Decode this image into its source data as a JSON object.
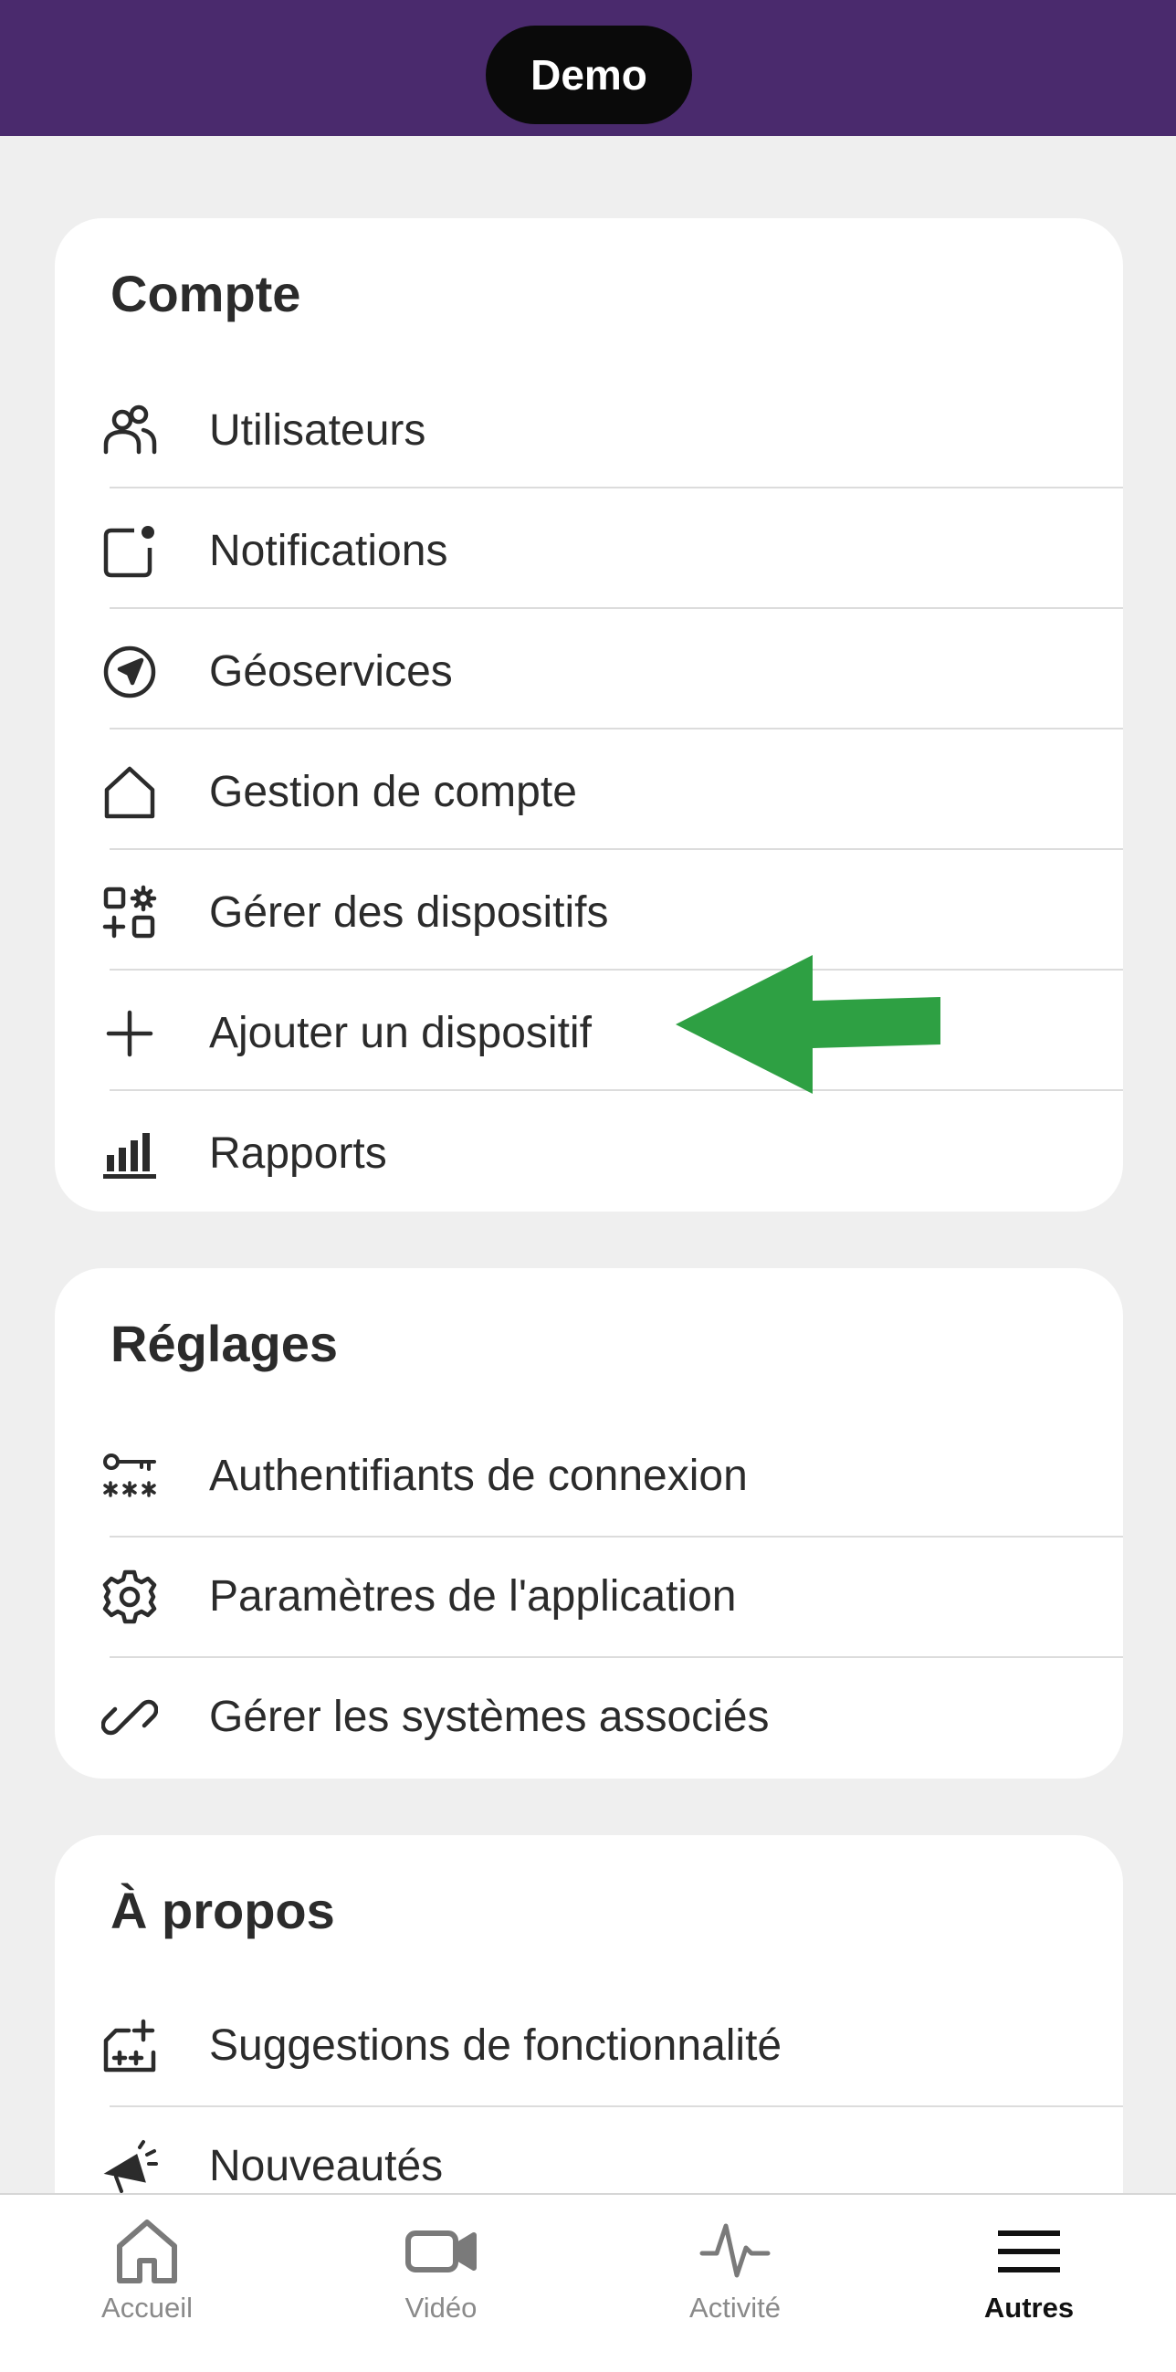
{
  "header": {
    "title": "Demo",
    "background": "#4a2a6d"
  },
  "sections": [
    {
      "title": "Compte",
      "items": [
        {
          "label": "Utilisateurs",
          "icon": "users-icon"
        },
        {
          "label": "Notifications",
          "icon": "notification-icon"
        },
        {
          "label": "Géoservices",
          "icon": "compass-icon"
        },
        {
          "label": "Gestion de compte",
          "icon": "home-icon"
        },
        {
          "label": "Gérer des dispositifs",
          "icon": "manage-devices-icon"
        },
        {
          "label": "Ajouter un dispositif",
          "icon": "plus-icon"
        },
        {
          "label": "Rapports",
          "icon": "bar-chart-icon"
        }
      ]
    },
    {
      "title": "Réglages",
      "items": [
        {
          "label": "Authentifiants de connexion",
          "icon": "key-password-icon"
        },
        {
          "label": "Paramètres de l'application",
          "icon": "gear-icon"
        },
        {
          "label": "Gérer les systèmes associés",
          "icon": "link-icon"
        }
      ]
    },
    {
      "title": "À propos",
      "items": [
        {
          "label": "Suggestions de fonctionnalité",
          "icon": "feature-suggestion-icon"
        },
        {
          "label": "Nouveautés",
          "icon": "megaphone-icon"
        }
      ]
    }
  ],
  "annotation": {
    "arrow_color": "#2ea043",
    "points_to": "Ajouter un dispositif"
  },
  "bottom_nav": {
    "tabs": [
      {
        "label": "Accueil",
        "icon": "home-icon",
        "active": false
      },
      {
        "label": "Vidéo",
        "icon": "video-camera-icon",
        "active": false
      },
      {
        "label": "Activité",
        "icon": "activity-pulse-icon",
        "active": false
      },
      {
        "label": "Autres",
        "icon": "menu-icon",
        "active": true
      }
    ]
  }
}
